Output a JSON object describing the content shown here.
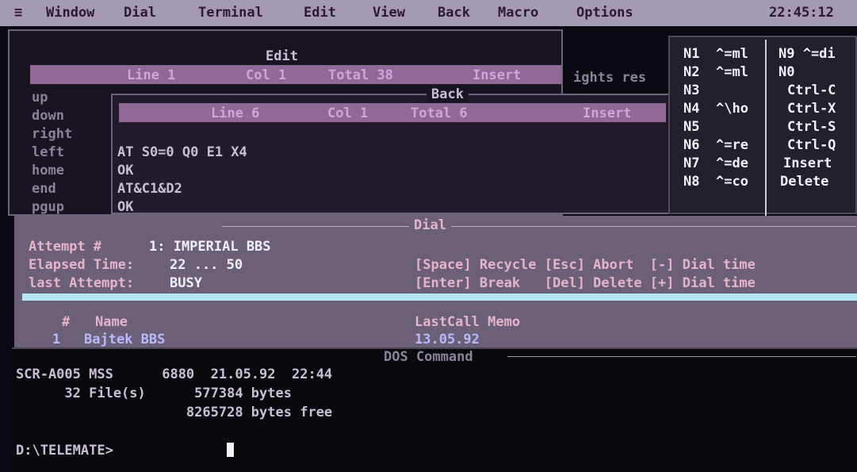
{
  "menu": {
    "items": [
      "≡",
      "Window",
      "Dial",
      "Terminal",
      "Edit",
      "View",
      "Back",
      "Macro",
      "Options"
    ],
    "clock": "22:45:12"
  },
  "edit_window": {
    "title": "Edit",
    "status": {
      "line": "Line 1",
      "col": "Col 1",
      "total": "Total 38",
      "mode": "Insert"
    },
    "clipped_text": "ights res",
    "keys": [
      "up",
      "down",
      "right",
      "left",
      "home",
      "end",
      "pgup"
    ]
  },
  "back_window": {
    "title": "Back",
    "status": {
      "line": "Line 6",
      "col": "Col 1",
      "total": "Total 6",
      "mode": "Insert"
    },
    "lines": [
      "AT S0=0 Q0 E1 X4",
      "OK",
      "AT&C1&D2",
      "OK"
    ]
  },
  "macro_panel": {
    "left": [
      {
        "key": "N1",
        "val": "^=ml"
      },
      {
        "key": "N2",
        "val": "^=ml"
      },
      {
        "key": "N3",
        "val": ""
      },
      {
        "key": "N4",
        "val": "^\\ho"
      },
      {
        "key": "N5",
        "val": ""
      },
      {
        "key": "N6",
        "val": "^=re"
      },
      {
        "key": "N7",
        "val": "^=de"
      },
      {
        "key": "N8",
        "val": "^=co"
      }
    ],
    "right": [
      "N9 ^=di",
      "N0",
      "Ctrl-C",
      "Ctrl-X",
      "Ctrl-S",
      "Ctrl-Q",
      "Insert",
      "Delete"
    ]
  },
  "dial_window": {
    "title": "Dial",
    "attempt_label": "Attempt #",
    "attempt_value": "1: IMPERIAL BBS",
    "elapsed_label": "Elapsed Time:",
    "elapsed_value": "22 ... 50",
    "last_label": "last Attempt:",
    "last_value": "BUSY",
    "hint_row1": "[Space] Recycle [Esc] Abort  [-] Dial time",
    "hint_row2": "[Enter] Break   [Del] Delete [+] Dial time",
    "table": {
      "headers": {
        "num": "#",
        "name": "Name",
        "lastcall": "LastCall Memo"
      },
      "rows": [
        {
          "num": "1",
          "name": "Bajtek BBS",
          "lastcall": "13.05.92"
        }
      ]
    }
  },
  "dos_window": {
    "title": "DOS Command",
    "lines": [
      "SCR-A005 MSS      6880  21.05.92  22:44",
      "      32 File(s)      577384 bytes",
      "                     8265728 bytes free"
    ],
    "prompt": "D:\\TELEMATE>"
  }
}
